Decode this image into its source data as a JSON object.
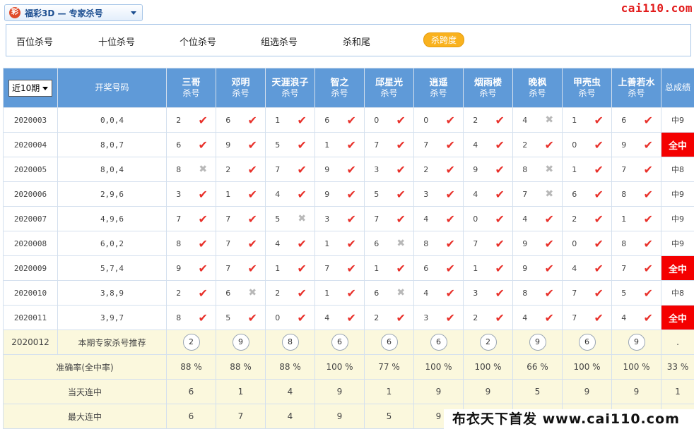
{
  "header": {
    "logo_glyph": "彩",
    "lottery_title": "福彩3D — 专家杀号",
    "site_logo": "cai110.com"
  },
  "nav": [
    "百位杀号",
    "十位杀号",
    "个位杀号",
    "组选杀号",
    "杀和尾",
    "杀跨度"
  ],
  "nav_active": 5,
  "table": {
    "period_select": "近10期",
    "draw_header": "开奖号码",
    "sub_label": "杀号",
    "total_header": "总成绩",
    "experts": [
      "三哥",
      "邓明",
      "天涯浪子",
      "智之",
      "邱星光",
      "逍遥",
      "烟雨楼",
      "晚枫",
      "甲壳虫",
      "上善若水"
    ],
    "rows": [
      {
        "issue": "2020003",
        "draw": "0,0,4",
        "picks": [
          2,
          6,
          1,
          6,
          0,
          0,
          2,
          4,
          1,
          6
        ],
        "hits": [
          1,
          1,
          1,
          1,
          1,
          1,
          1,
          0,
          1,
          1
        ],
        "total": "中9",
        "full": false
      },
      {
        "issue": "2020004",
        "draw": "8,0,7",
        "picks": [
          6,
          9,
          5,
          1,
          7,
          7,
          4,
          2,
          0,
          9
        ],
        "hits": [
          1,
          1,
          1,
          1,
          1,
          1,
          1,
          1,
          1,
          1
        ],
        "total": "全中",
        "full": true
      },
      {
        "issue": "2020005",
        "draw": "8,0,4",
        "picks": [
          8,
          2,
          7,
          9,
          3,
          2,
          9,
          8,
          1,
          7
        ],
        "hits": [
          0,
          1,
          1,
          1,
          1,
          1,
          1,
          0,
          1,
          1
        ],
        "total": "中8",
        "full": false
      },
      {
        "issue": "2020006",
        "draw": "2,9,6",
        "picks": [
          3,
          1,
          4,
          9,
          5,
          3,
          4,
          7,
          6,
          8
        ],
        "hits": [
          1,
          1,
          1,
          1,
          1,
          1,
          1,
          0,
          1,
          1
        ],
        "total": "中9",
        "full": false
      },
      {
        "issue": "2020007",
        "draw": "4,9,6",
        "picks": [
          7,
          7,
          5,
          3,
          7,
          4,
          0,
          4,
          2,
          1
        ],
        "hits": [
          1,
          1,
          0,
          1,
          1,
          1,
          1,
          1,
          1,
          1
        ],
        "total": "中9",
        "full": false
      },
      {
        "issue": "2020008",
        "draw": "6,0,2",
        "picks": [
          8,
          7,
          4,
          1,
          6,
          8,
          7,
          9,
          0,
          8
        ],
        "hits": [
          1,
          1,
          1,
          1,
          0,
          1,
          1,
          1,
          1,
          1
        ],
        "total": "中9",
        "full": false
      },
      {
        "issue": "2020009",
        "draw": "5,7,4",
        "picks": [
          9,
          7,
          1,
          7,
          1,
          6,
          1,
          9,
          4,
          7
        ],
        "hits": [
          1,
          1,
          1,
          1,
          1,
          1,
          1,
          1,
          1,
          1
        ],
        "total": "全中",
        "full": true
      },
      {
        "issue": "2020010",
        "draw": "3,8,9",
        "picks": [
          2,
          6,
          2,
          1,
          6,
          4,
          3,
          8,
          7,
          5
        ],
        "hits": [
          1,
          0,
          1,
          1,
          0,
          1,
          1,
          1,
          1,
          1
        ],
        "total": "中8",
        "full": false
      },
      {
        "issue": "2020011",
        "draw": "3,9,7",
        "picks": [
          8,
          5,
          0,
          4,
          2,
          3,
          2,
          4,
          7,
          4
        ],
        "hits": [
          1,
          1,
          1,
          1,
          1,
          1,
          1,
          1,
          1,
          1
        ],
        "total": "全中",
        "full": true
      }
    ],
    "recommend": {
      "issue": "2020012",
      "label": "本期专家杀号推荐",
      "values": [
        "2",
        "9",
        "8",
        "6",
        "6",
        "6",
        "2",
        "9",
        "6",
        "9"
      ],
      "total": "."
    },
    "accuracy": {
      "label": "准确率(全中率)",
      "values": [
        "88 %",
        "88 %",
        "88 %",
        "100 %",
        "77 %",
        "100 %",
        "100 %",
        "66 %",
        "100 %",
        "100 %"
      ],
      "total": "33 %"
    },
    "current_streak": {
      "label": "当天连中",
      "values": [
        "6",
        "1",
        "4",
        "9",
        "1",
        "9",
        "9",
        "5",
        "9",
        "9"
      ],
      "total": "1"
    },
    "max_streak": {
      "label": "最大连中",
      "values": [
        "6",
        "7",
        "4",
        "9",
        "5",
        "9"
      ]
    }
  },
  "watermark": "布衣天下首发 www.cai110.com",
  "colors": {
    "header_blue": "#5f9ad8",
    "check_red": "#e8302a",
    "full_red": "#f40000",
    "highlight_yellow": "#fbf8dd",
    "nav_active": "#f9b21e"
  }
}
